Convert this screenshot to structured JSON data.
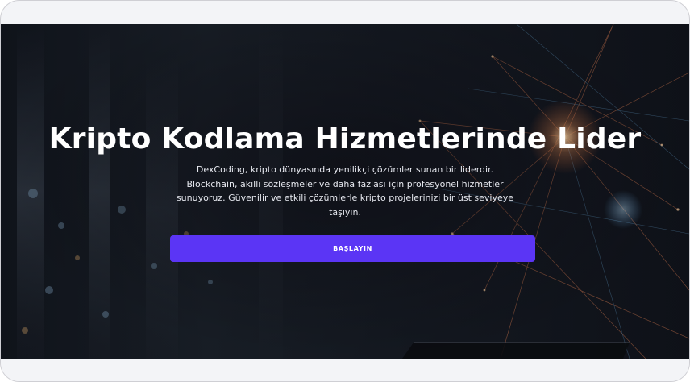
{
  "hero": {
    "title": "Kripto Kodlama Hizmetlerinde Lider",
    "description": "DexCoding, kripto dünyasında yenilikçi çözümler sunan bir liderdir. Blockchain, akıllı sözleşmeler ve daha fazlası için profesyonel hizmetler sunuyoruz. Güvenilir ve etkili çözümlerle kripto projelerinizi bir üst seviyeye taşıyın.",
    "cta_label": "BAŞLAYIN",
    "background_image": "crypto-network-lights-background"
  },
  "colors": {
    "accent": "#5b35f5",
    "hero_overlay": "#11151d",
    "page_background": "#f3f4f7"
  }
}
